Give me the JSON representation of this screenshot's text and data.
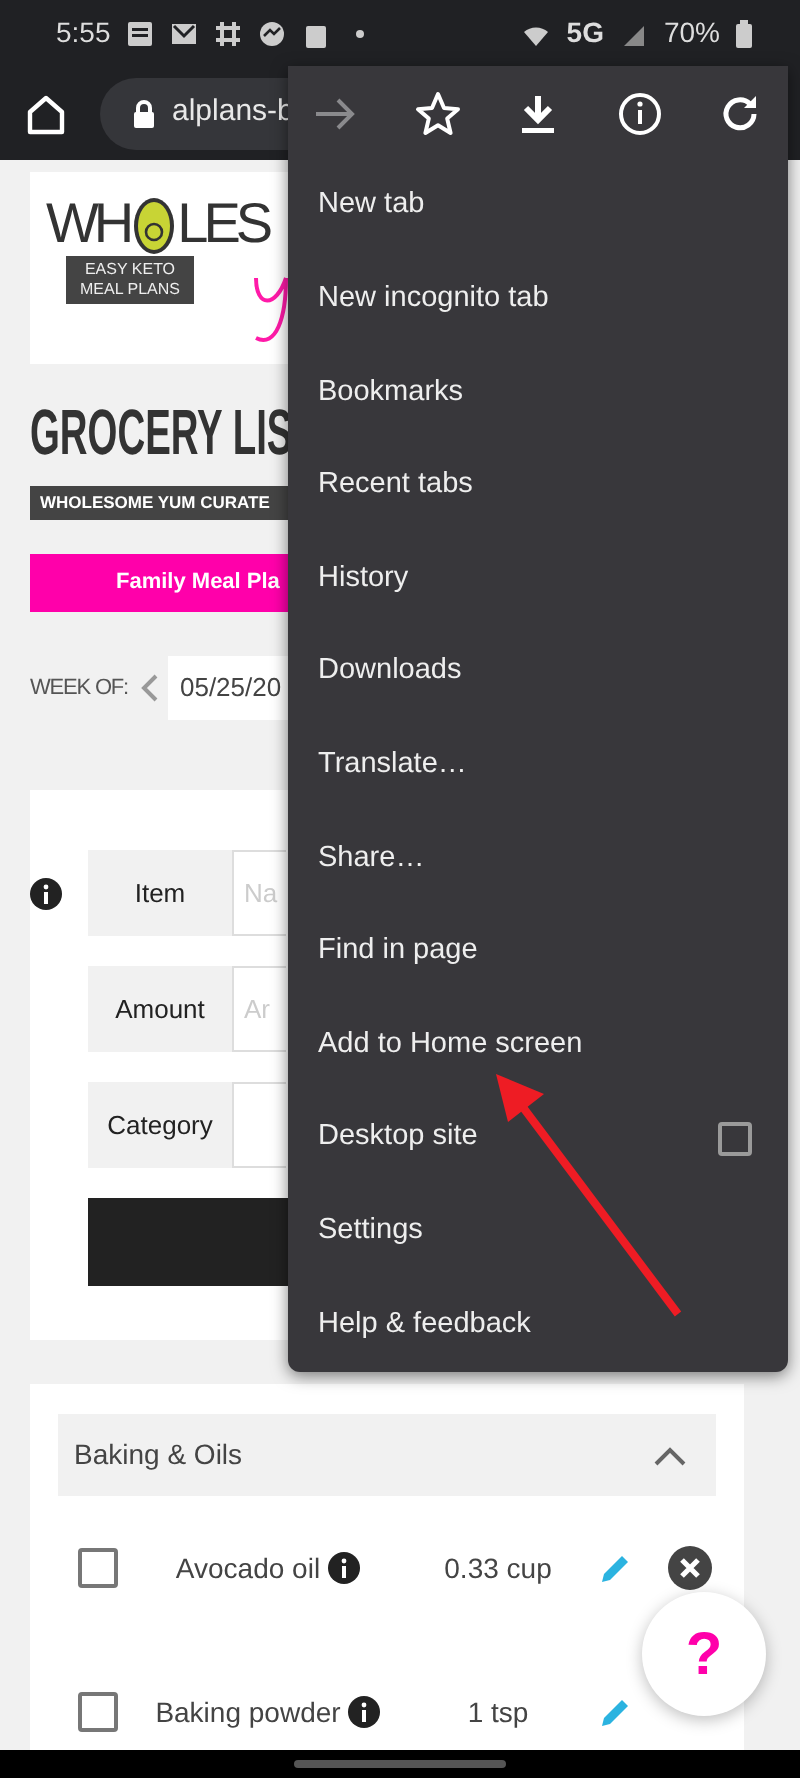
{
  "status_bar": {
    "time": "5:55",
    "network": "5G",
    "battery": "70%"
  },
  "browser": {
    "url": "alplans-b"
  },
  "page": {
    "logo_left": "WH",
    "logo_right": "LES",
    "logo_tag": [
      "EASY KETO",
      "MEAL PLANS"
    ],
    "title": "GROCERY LIS",
    "subtitle": "WHOLESOME YUM CURATE",
    "plan_tab": {
      "label": "Family Meal Pla",
      "selected": true
    },
    "week_label": "WEEK OF:",
    "week_value": "05/25/20",
    "form": {
      "fields": [
        {
          "label": "Item",
          "placeholder": "Na"
        },
        {
          "label": "Amount",
          "placeholder": "Ar"
        },
        {
          "label": "Category"
        }
      ]
    },
    "category": {
      "title": "Baking & Oils",
      "expanded": true,
      "items": [
        {
          "name": "Avocado oil",
          "amount": "0.33 cup",
          "checked": false,
          "removable": true
        },
        {
          "name": "Baking powder",
          "amount": "1 tsp",
          "checked": false,
          "removable": false
        }
      ]
    }
  },
  "menu": {
    "actions": [
      {
        "kind": "forward",
        "disabled": true
      },
      {
        "kind": "bookmark",
        "disabled": false
      },
      {
        "kind": "download",
        "disabled": false
      },
      {
        "kind": "info",
        "disabled": false
      },
      {
        "kind": "reload",
        "disabled": false
      }
    ],
    "items": [
      {
        "label": "New tab"
      },
      {
        "label": "New incognito tab"
      },
      {
        "label": "Bookmarks"
      },
      {
        "label": "Recent tabs"
      },
      {
        "label": "History"
      },
      {
        "label": "Downloads"
      },
      {
        "label": "Translate…"
      },
      {
        "label": "Share…"
      },
      {
        "label": "Find in page"
      },
      {
        "label": "Add to Home screen"
      },
      {
        "label": "Desktop site",
        "kind": "checkbox",
        "checked": false
      },
      {
        "label": "Settings"
      },
      {
        "label": "Help & feedback"
      }
    ]
  },
  "help_button": {
    "label": "?"
  }
}
